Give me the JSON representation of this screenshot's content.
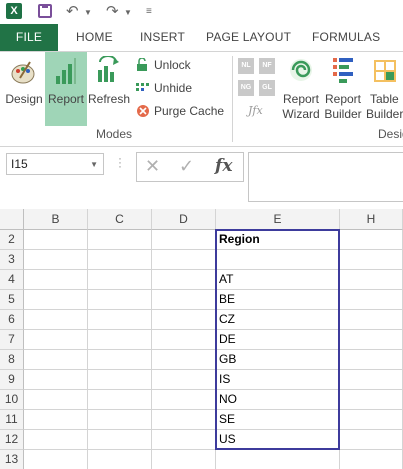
{
  "quick_access": {
    "app_icon": "excel-icon",
    "items": [
      "save-icon",
      "undo-icon",
      "undo-dropdown-icon",
      "redo-icon",
      "redo-dropdown-icon",
      "customize-qat-icon"
    ]
  },
  "tabs": [
    {
      "label": "FILE",
      "active": true
    },
    {
      "label": "HOME"
    },
    {
      "label": "INSERT"
    },
    {
      "label": "PAGE LAYOUT"
    },
    {
      "label": "FORMULAS"
    }
  ],
  "ribbon": {
    "modes_group": {
      "label": "Modes",
      "design": "Design",
      "report": "Report",
      "refresh": "Refresh",
      "unlock": "Unlock",
      "unhide": "Unhide",
      "purge_cache": "Purge Cache"
    },
    "second_group": {
      "jfx": "Jfx",
      "report_wizard": [
        "Report",
        "Wizard"
      ],
      "report_builder": [
        "Report",
        "Builder"
      ],
      "table_builder": [
        "Table",
        "Builder"
      ],
      "label_partial": "Desig"
    },
    "small_box_labels": [
      "NL",
      "NF",
      "NG",
      "GL"
    ]
  },
  "formula_bar": {
    "name_box": "I15",
    "formula": "",
    "fx_label": "fx"
  },
  "grid": {
    "columns": [
      "B",
      "C",
      "D",
      "E",
      "H"
    ],
    "rows": [
      {
        "num": "2",
        "e": "Region"
      },
      {
        "num": "3",
        "e": ""
      },
      {
        "num": "4",
        "e": "AT"
      },
      {
        "num": "5",
        "e": "BE"
      },
      {
        "num": "6",
        "e": "CZ"
      },
      {
        "num": "7",
        "e": "DE"
      },
      {
        "num": "8",
        "e": "GB"
      },
      {
        "num": "9",
        "e": "IS"
      },
      {
        "num": "10",
        "e": "NO"
      },
      {
        "num": "11",
        "e": "SE"
      },
      {
        "num": "12",
        "e": "US"
      },
      {
        "num": "13",
        "e": ""
      }
    ]
  },
  "colors": {
    "file_tab": "#217346",
    "active_button": "#9fd5b7",
    "selection_border": "#3d3b9c"
  }
}
